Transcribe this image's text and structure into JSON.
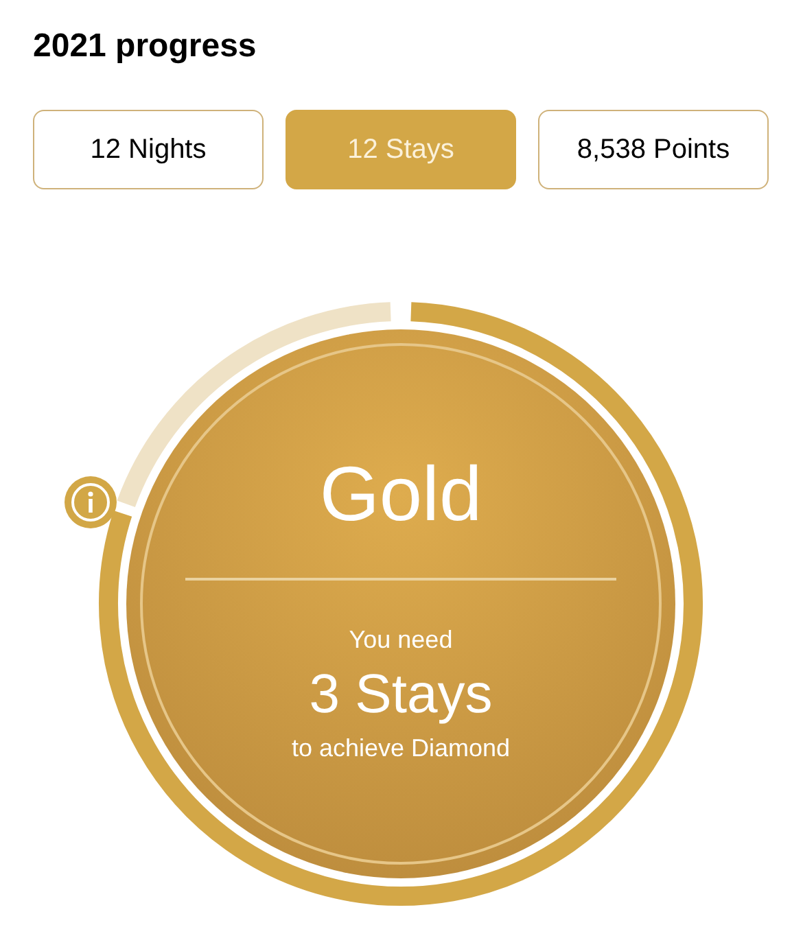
{
  "title": "2021 progress",
  "tabs": [
    {
      "label": "12 Nights",
      "selected": false
    },
    {
      "label": "12 Stays",
      "selected": true
    },
    {
      "label": "8,538 Points",
      "selected": false
    }
  ],
  "progress": {
    "tier": "Gold",
    "line_1": "You need",
    "remaining": "3 Stays",
    "line_2": "to achieve Diamond"
  }
}
